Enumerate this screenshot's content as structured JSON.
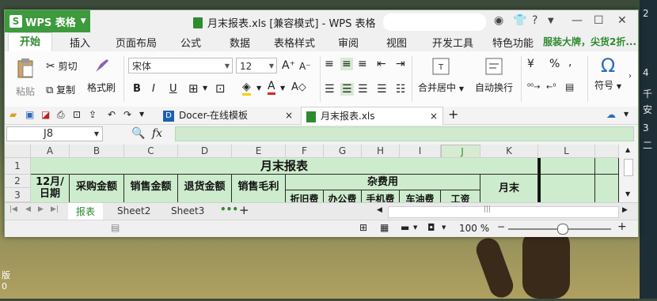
{
  "app": {
    "name": "WPS 表格"
  },
  "window": {
    "title": "月末报表.xls [兼容模式] - WPS 表格"
  },
  "menu": {
    "tabs": [
      "开始",
      "插入",
      "页面布局",
      "公式",
      "数据",
      "表格样式",
      "审阅",
      "视图",
      "开发工具",
      "特色功能"
    ],
    "promo": "服装大牌，尖货2折..."
  },
  "ribbon": {
    "paste": "粘贴",
    "cut": "剪切",
    "copy": "复制",
    "format_painter": "格式刷",
    "font": "宋体",
    "size": "12",
    "merge_center": "合并居中",
    "wrap_text": "自动换行",
    "symbol": "符号",
    "percent": "%",
    "comma": ",",
    "font_color": "A",
    "bold": "B",
    "italic": "I",
    "underline": "U"
  },
  "doc_tabs": {
    "docer": "Docer-在线模板",
    "current": "月末报表.xls"
  },
  "formula_bar": {
    "name_box": "J8",
    "fx": "fx",
    "value": ""
  },
  "sheet": {
    "columns": [
      "A",
      "B",
      "C",
      "D",
      "E",
      "F",
      "G",
      "H",
      "I",
      "J",
      "K",
      "L"
    ],
    "rows": [
      "1",
      "2",
      "3"
    ],
    "title": "月末报表",
    "headers": {
      "a": "12月/\n日期",
      "b": "采购金额",
      "c": "销售金额",
      "d": "退货金额",
      "e": "销售毛利",
      "misc": "杂费用",
      "f": "折旧费",
      "g": "办公费",
      "h": "手机费",
      "i": "车油费",
      "j": "工资",
      "k": "月末"
    }
  },
  "sheet_tabs": [
    "报表",
    "Sheet2",
    "Sheet3"
  ],
  "status": {
    "zoom": "100 %"
  },
  "desktop": {
    "right_labels": [
      "2",
      "4",
      "千",
      "安",
      "3",
      "二"
    ],
    "left_labels": [
      "版",
      "0"
    ]
  }
}
